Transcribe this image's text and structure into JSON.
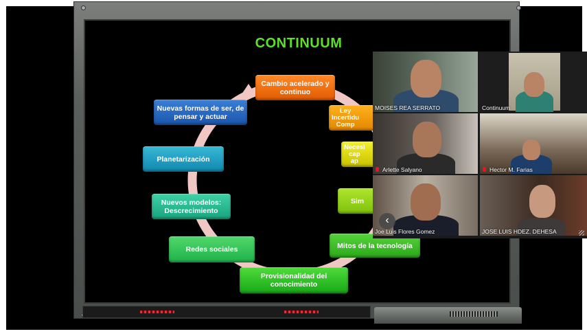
{
  "slide": {
    "title": "CONTINUUM",
    "nodes": {
      "cambio": "Cambio acelerado y continuo",
      "ley": "Ley\nIncertidu\nComp",
      "necesidad": "Necesi\ncap\nap",
      "sim": "Sim",
      "mitos": "Mitos de la tecnología",
      "provisionalidad": "Provisionalidad del conocimiento",
      "redes": "Redes sociales",
      "modelos": "Nuevos modelos: Descrecimiento",
      "planetarizacion": "Planetarización",
      "formas": "Nuevas formas de ser, de pensar y actuar"
    }
  },
  "participants": [
    {
      "name": "MOISES REA SERRATO",
      "muted": false
    },
    {
      "name": "Continuum",
      "muted": false
    },
    {
      "name": "Arlette Salyano",
      "muted": true
    },
    {
      "name": "Hector M. Farias",
      "muted": true
    },
    {
      "name": "Joe Luis Flores Gomez",
      "muted": false
    },
    {
      "name": "JOSE LUIS HDEZ. DEHESA",
      "muted": false
    }
  ],
  "gallery": {
    "back_glyph": "‹"
  }
}
